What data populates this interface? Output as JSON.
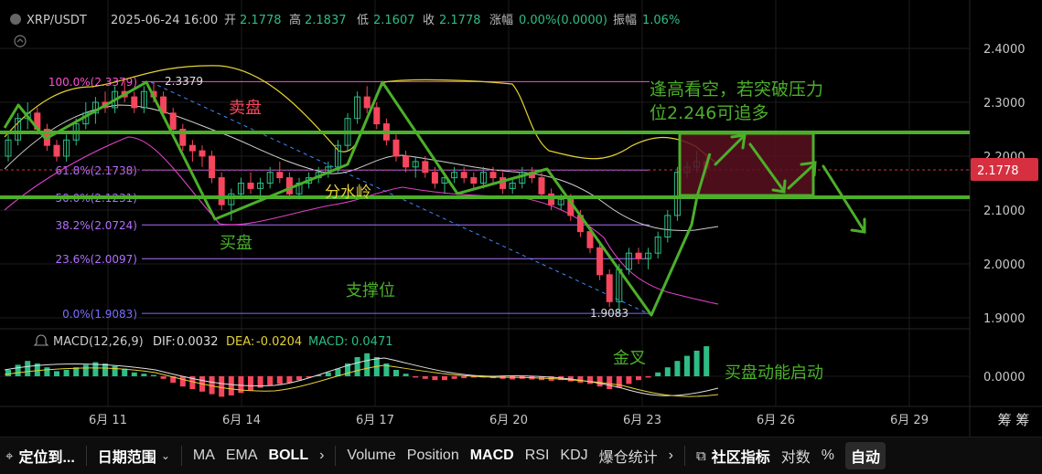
{
  "header": {
    "pair": "XRP/USDT",
    "datetime": "2025-06-24 16:00",
    "open_label": "开",
    "open": "2.1778",
    "high_label": "高",
    "high": "2.1837",
    "low_label": "低",
    "low": "2.1607",
    "close_label": "收",
    "close": "2.1778",
    "change_label": "涨幅",
    "change": "0.00%(0.0000)",
    "amp_label": "振幅",
    "amp": "1.06%"
  },
  "price_axis": [
    "2.4000",
    "2.3000",
    "2.2000",
    "2.1000",
    "2.0000",
    "1.9000"
  ],
  "current_price": "2.1778",
  "fib": [
    {
      "label": "100.0%(2.3379)",
      "price": 2.3379,
      "color": "#ff4fd8"
    },
    {
      "label": "61.8%(2.1738)",
      "price": 2.1738,
      "color": "#b070ff"
    },
    {
      "label": "50.0%(2.1231)",
      "price": 2.1231,
      "color": "#b070ff"
    },
    {
      "label": "38.2%(2.0724)",
      "price": 2.0724,
      "color": "#b070ff"
    },
    {
      "label": "23.6%(2.0097)",
      "price": 2.0097,
      "color": "#b070ff"
    },
    {
      "label": "0.0%(1.9083)",
      "price": 1.9083,
      "color": "#7a6dff"
    }
  ],
  "fib_high_mark": "2.3379",
  "fib_low_mark": "1.9083",
  "macd": {
    "title": "MACD(12,26,9)",
    "dif_label": "DIF:",
    "dif": "0.0032",
    "dea_label": "DEA:",
    "dea": "-0.0204",
    "macd_label": "MACD:",
    "macd_val": "0.0471",
    "axis": "0.0000"
  },
  "dates": [
    "6月 11",
    "6月 14",
    "6月 17",
    "6月 20",
    "6月 23",
    "6月 26",
    "6月 29"
  ],
  "axis_corner": "筹 筹",
  "annotations": {
    "sell": "卖盘",
    "divide": "分水岭",
    "buy": "买盘",
    "support": "支撑位",
    "golden_cross": "金叉",
    "buy_momentum": "买盘动能启动",
    "note_line1": "逢高看空，若突破压力",
    "note_line2": "位2.246可追多"
  },
  "toolbar": {
    "locate": "定位到...",
    "date_range": "日期范围",
    "ma": "MA",
    "ema": "EMA",
    "boll": "BOLL",
    "volume": "Volume",
    "position": "Position",
    "macd": "MACD",
    "rsi": "RSI",
    "kdj": "KDJ",
    "liquidation": "爆仓统计",
    "community": "社区指标",
    "log": "对数",
    "percent": "%",
    "auto": "自动"
  },
  "colors": {
    "up": "#2ebd85",
    "down": "#f6465d",
    "accent_green": "#4caf2a",
    "boll_upper": "#e6d234",
    "boll_mid": "#d0d0d0",
    "boll_lower": "#e040c8",
    "price_tag": "#d63040"
  },
  "chart_data": {
    "type": "candlestick",
    "symbol": "XRP/USDT",
    "ylim": [
      1.88,
      2.43
    ],
    "candles": [
      [
        2.2,
        2.24,
        2.19,
        2.23
      ],
      [
        2.23,
        2.28,
        2.22,
        2.27
      ],
      [
        2.27,
        2.3,
        2.25,
        2.28
      ],
      [
        2.28,
        2.29,
        2.24,
        2.25
      ],
      [
        2.25,
        2.26,
        2.21,
        2.22
      ],
      [
        2.22,
        2.23,
        2.19,
        2.2
      ],
      [
        2.2,
        2.24,
        2.19,
        2.23
      ],
      [
        2.23,
        2.27,
        2.22,
        2.26
      ],
      [
        2.26,
        2.3,
        2.25,
        2.28
      ],
      [
        2.28,
        2.31,
        2.26,
        2.3
      ],
      [
        2.3,
        2.32,
        2.28,
        2.29
      ],
      [
        2.29,
        2.33,
        2.28,
        2.32
      ],
      [
        2.32,
        2.34,
        2.3,
        2.31
      ],
      [
        2.31,
        2.32,
        2.28,
        2.29
      ],
      [
        2.29,
        2.33,
        2.28,
        2.32
      ],
      [
        2.32,
        2.338,
        2.3,
        2.31
      ],
      [
        2.31,
        2.32,
        2.27,
        2.28
      ],
      [
        2.28,
        2.29,
        2.24,
        2.25
      ],
      [
        2.25,
        2.26,
        2.21,
        2.22
      ],
      [
        2.22,
        2.23,
        2.19,
        2.21
      ],
      [
        2.21,
        2.22,
        2.18,
        2.2
      ],
      [
        2.2,
        2.21,
        2.15,
        2.16
      ],
      [
        2.16,
        2.17,
        2.1,
        2.11
      ],
      [
        2.11,
        2.14,
        2.08,
        2.13
      ],
      [
        2.13,
        2.16,
        2.12,
        2.15
      ],
      [
        2.15,
        2.17,
        2.13,
        2.14
      ],
      [
        2.14,
        2.16,
        2.12,
        2.15
      ],
      [
        2.15,
        2.18,
        2.14,
        2.17
      ],
      [
        2.17,
        2.19,
        2.15,
        2.16
      ],
      [
        2.16,
        2.17,
        2.12,
        2.13
      ],
      [
        2.13,
        2.16,
        2.12,
        2.15
      ],
      [
        2.15,
        2.17,
        2.14,
        2.16
      ],
      [
        2.16,
        2.18,
        2.15,
        2.17
      ],
      [
        2.17,
        2.19,
        2.16,
        2.18
      ],
      [
        2.18,
        2.23,
        2.17,
        2.22
      ],
      [
        2.22,
        2.28,
        2.21,
        2.27
      ],
      [
        2.27,
        2.32,
        2.26,
        2.31
      ],
      [
        2.31,
        2.33,
        2.28,
        2.29
      ],
      [
        2.29,
        2.3,
        2.25,
        2.26
      ],
      [
        2.26,
        2.27,
        2.22,
        2.23
      ],
      [
        2.23,
        2.24,
        2.19,
        2.2
      ],
      [
        2.2,
        2.21,
        2.17,
        2.18
      ],
      [
        2.18,
        2.2,
        2.16,
        2.19
      ],
      [
        2.19,
        2.2,
        2.16,
        2.17
      ],
      [
        2.17,
        2.18,
        2.14,
        2.15
      ],
      [
        2.15,
        2.17,
        2.13,
        2.16
      ],
      [
        2.16,
        2.18,
        2.15,
        2.17
      ],
      [
        2.17,
        2.18,
        2.15,
        2.16
      ],
      [
        2.16,
        2.17,
        2.14,
        2.15
      ],
      [
        2.15,
        2.18,
        2.14,
        2.17
      ],
      [
        2.17,
        2.18,
        2.15,
        2.16
      ],
      [
        2.16,
        2.17,
        2.13,
        2.14
      ],
      [
        2.14,
        2.16,
        2.13,
        2.15
      ],
      [
        2.15,
        2.18,
        2.14,
        2.17
      ],
      [
        2.17,
        2.18,
        2.15,
        2.16
      ],
      [
        2.16,
        2.17,
        2.12,
        2.13
      ],
      [
        2.13,
        2.14,
        2.1,
        2.11
      ],
      [
        2.11,
        2.13,
        2.1,
        2.12
      ],
      [
        2.12,
        2.13,
        2.08,
        2.09
      ],
      [
        2.09,
        2.1,
        2.05,
        2.06
      ],
      [
        2.06,
        2.07,
        2.02,
        2.03
      ],
      [
        2.03,
        2.04,
        1.97,
        1.98
      ],
      [
        1.98,
        1.99,
        1.92,
        1.93
      ],
      [
        1.93,
        2.0,
        1.91,
        1.99
      ],
      [
        1.99,
        2.03,
        1.98,
        2.02
      ],
      [
        2.02,
        2.03,
        2.0,
        2.01
      ],
      [
        2.01,
        2.03,
        1.99,
        2.02
      ],
      [
        2.02,
        2.06,
        2.01,
        2.05
      ],
      [
        2.05,
        2.1,
        2.04,
        2.09
      ],
      [
        2.09,
        2.18,
        2.08,
        2.17
      ],
      [
        2.17,
        2.19,
        2.16,
        2.18
      ],
      [
        2.18,
        2.21,
        2.17,
        2.19
      ],
      [
        2.19,
        2.2,
        2.16,
        2.1778
      ]
    ],
    "macd_hist": [
      0.01,
      0.018,
      0.024,
      0.02,
      0.014,
      0.008,
      0.01,
      0.014,
      0.018,
      0.022,
      0.02,
      0.016,
      0.012,
      0.006,
      0.004,
      0.002,
      -0.004,
      -0.01,
      -0.016,
      -0.02,
      -0.024,
      -0.028,
      -0.032,
      -0.03,
      -0.026,
      -0.022,
      -0.018,
      -0.014,
      -0.012,
      -0.01,
      -0.006,
      -0.002,
      0.002,
      0.006,
      0.012,
      0.02,
      0.03,
      0.036,
      0.03,
      0.02,
      0.01,
      0.004,
      -0.002,
      -0.004,
      -0.006,
      -0.006,
      -0.004,
      -0.003,
      -0.002,
      -0.002,
      -0.003,
      -0.004,
      -0.005,
      -0.004,
      -0.005,
      -0.006,
      -0.007,
      -0.006,
      -0.008,
      -0.01,
      -0.012,
      -0.016,
      -0.02,
      -0.018,
      -0.012,
      -0.006,
      -0.002,
      0.006,
      0.014,
      0.024,
      0.032,
      0.04,
      0.047
    ]
  }
}
